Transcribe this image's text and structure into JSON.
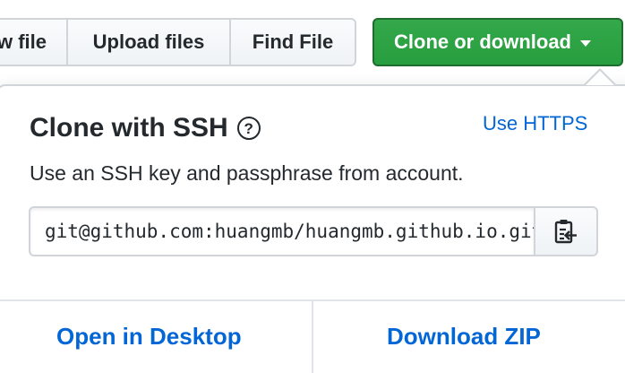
{
  "toolbar": {
    "new_file_label": "w file",
    "upload_label": "Upload files",
    "find_label": "Find File",
    "clone_label": "Clone or download"
  },
  "clone_panel": {
    "title": "Clone with SSH",
    "help_symbol": "?",
    "switch_link": "Use HTTPS",
    "description": "Use an SSH key and passphrase from account.",
    "url": "git@github.com:huangmb/huangmb.github.io.git",
    "open_desktop_label": "Open in Desktop",
    "download_zip_label": "Download ZIP"
  },
  "icons": {
    "help": "question-circle-icon",
    "copy": "clipboard-icon",
    "dropdown": "caret-down-icon"
  },
  "colors": {
    "primary_button": "#2ea44f",
    "link": "#0366d6",
    "text": "#24292e",
    "border": "#d1d5da"
  }
}
